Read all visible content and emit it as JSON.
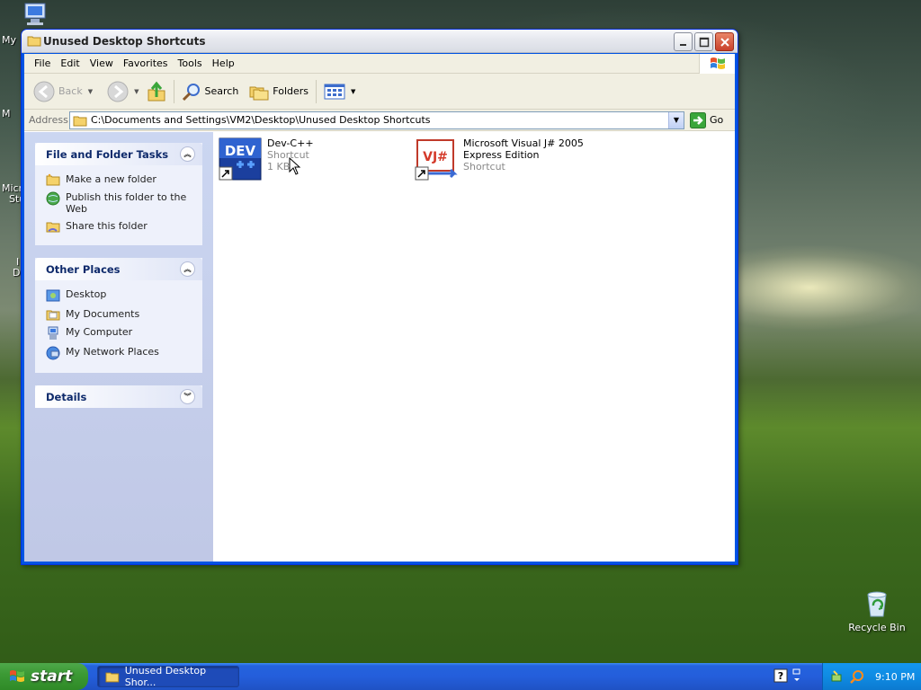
{
  "desktop": {
    "left_labels": [
      "My",
      "M",
      "Micro",
      "Stu",
      "I",
      "D"
    ],
    "recycle_bin": "Recycle Bin"
  },
  "window": {
    "title": "Unused Desktop Shortcuts",
    "menu": [
      "File",
      "Edit",
      "View",
      "Favorites",
      "Tools",
      "Help"
    ],
    "toolbar": {
      "back": "Back",
      "search": "Search",
      "folders": "Folders"
    },
    "address": {
      "label": "Address",
      "path": "C:\\Documents and Settings\\VM2\\Desktop\\Unused Desktop Shortcuts",
      "go": "Go"
    },
    "tasks": {
      "title": "File and Folder Tasks",
      "items": [
        "Make a new folder",
        "Publish this folder to the Web",
        "Share this folder"
      ]
    },
    "other_places": {
      "title": "Other Places",
      "items": [
        "Desktop",
        "My Documents",
        "My Computer",
        "My Network Places"
      ]
    },
    "details": {
      "title": "Details"
    },
    "files": [
      {
        "name": "Dev-C++",
        "type": "Shortcut",
        "size": "1 KB",
        "icon_text": "DEV"
      },
      {
        "name": "Microsoft Visual J# 2005 Express Edition",
        "type": "Shortcut",
        "icon_text": "VJ#"
      }
    ]
  },
  "taskbar": {
    "start": "start",
    "task": "Unused Desktop Shor...",
    "clock": "9:10 PM"
  },
  "colors": {
    "taskbar_blue": "#245edb",
    "start_green": "#3c9a35",
    "task_link": "#215dc6"
  }
}
